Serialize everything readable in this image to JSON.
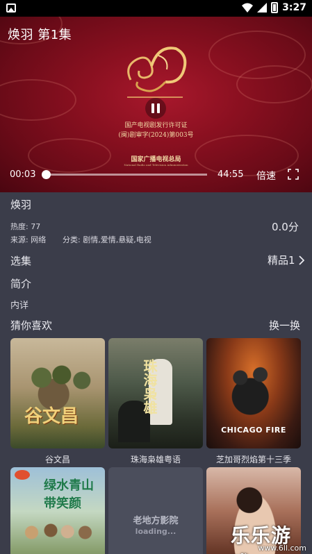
{
  "status_bar": {
    "time": "3:27"
  },
  "player": {
    "title": "焕羽 第1集",
    "license_line1": "国产电视剧发行许可证",
    "license_line2": "(闽)剧审字(2024)第003号",
    "license_org": "国家广播电视总局",
    "license_org_en": "National Radio and Television Administration",
    "current_time": "00:03",
    "duration": "44:55",
    "progress_fraction": 0.001,
    "speed_label": "倍速"
  },
  "info": {
    "name": "焕羽",
    "heat": "热度: 77",
    "source": "来源: 网络",
    "category": "分类: 剧情,爱情,悬疑,电视",
    "score": "0.0分"
  },
  "episodes": {
    "label": "选集",
    "source_value": "精品1"
  },
  "intro": {
    "label": "简介",
    "detail": "内详"
  },
  "recommend": {
    "label": "猜你喜欢",
    "swap_label": "换一换",
    "items": [
      {
        "caption": "谷文昌",
        "poster_text": "谷文昌"
      },
      {
        "caption": "珠海枭雄粤语",
        "poster_text": "珠海枭雄"
      },
      {
        "caption": "芝加哥烈焰第十三季",
        "poster_text": "CHICAGO FIRE"
      },
      {
        "caption": "",
        "poster_text": "绿水青山带笑颜"
      },
      {
        "caption": "",
        "loading_title": "老地方影院",
        "loading_sub": "loading..."
      },
      {
        "caption": ""
      }
    ]
  },
  "watermark": {
    "line1": "乐乐游戏",
    "line2": "www.6ll.com"
  },
  "colors": {
    "background": "#3b3d4a",
    "player_red": "#8a1020",
    "gold": "#f1d9a5"
  }
}
